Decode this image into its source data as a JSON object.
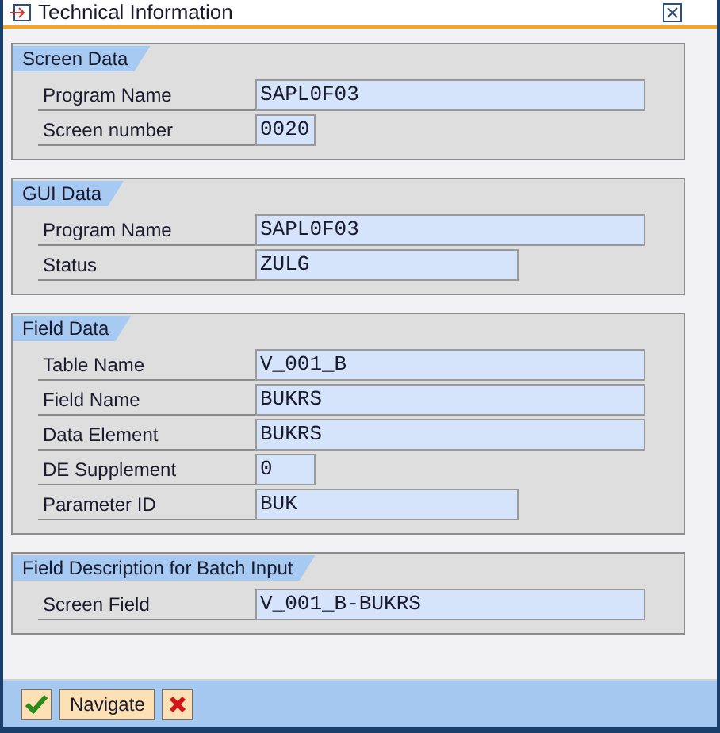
{
  "window": {
    "title": "Technical Information"
  },
  "groups": [
    {
      "title": "Screen Data",
      "fields": [
        {
          "label": "Program Name",
          "value": "SAPL0F03",
          "kind": "long"
        },
        {
          "label": "Screen number",
          "value": "0020",
          "kind": "short"
        }
      ]
    },
    {
      "title": "GUI Data",
      "fields": [
        {
          "label": "Program Name",
          "value": "SAPL0F03",
          "kind": "long"
        },
        {
          "label": "Status",
          "value": "ZULG",
          "kind": "medium"
        }
      ]
    },
    {
      "title": "Field Data",
      "fields": [
        {
          "label": "Table Name",
          "value": "V_001_B",
          "kind": "long"
        },
        {
          "label": "Field Name",
          "value": "BUKRS",
          "kind": "long"
        },
        {
          "label": "Data Element",
          "value": "BUKRS",
          "kind": "long"
        },
        {
          "label": "DE Supplement",
          "value": "0",
          "kind": "short"
        },
        {
          "label": "Parameter ID",
          "value": "BUK",
          "kind": "medium"
        }
      ]
    },
    {
      "title": "Field Description for Batch Input",
      "fields": [
        {
          "label": "Screen Field",
          "value": "V_001_B-BUKRS",
          "kind": "long"
        }
      ]
    }
  ],
  "footer": {
    "navigate": "Navigate"
  }
}
